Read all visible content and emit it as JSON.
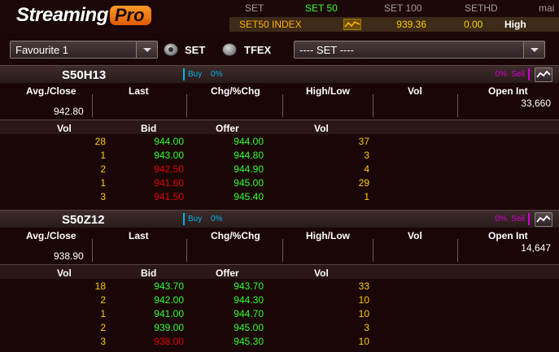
{
  "logo": {
    "part1": "Streaming",
    "part2": "Pro"
  },
  "index_tabs": [
    {
      "label": "SET",
      "active": false
    },
    {
      "label": "SET 50",
      "active": true
    },
    {
      "label": "SET 100",
      "active": false
    },
    {
      "label": "SETHD",
      "active": false
    },
    {
      "label": "mai",
      "active": false
    }
  ],
  "index_row": {
    "name": "SET50 INDEX",
    "last": "939.36",
    "change": "0.00",
    "high_low_label": "High"
  },
  "selector": {
    "favourite": "Favourite 1",
    "radio_set": "SET",
    "radio_tfex": "TFEX",
    "set_dropdown": "---- SET ----"
  },
  "columns": {
    "avg_close": "Avg./Close",
    "last": "Last",
    "chg": "Chg/%Chg",
    "high_low": "High/Low",
    "vol": "Vol",
    "open_int": "Open Int"
  },
  "book_columns": {
    "vol_bid": "Vol",
    "bid": "Bid",
    "offer": "Offer",
    "vol_offer": "Vol"
  },
  "colors": {
    "buy": "#00b4e6",
    "sell": "#d400d4",
    "up": "#33ff33",
    "down": "#e00000",
    "volume": "#ffcc00",
    "accent": "#ff8a00"
  },
  "panels": [
    {
      "symbol": "S50H13",
      "buy_label": "Buy",
      "buy_pct": "0%",
      "sell_label": "Sell",
      "sell_pct": "0%",
      "close": "942.80",
      "open_int": "33,660",
      "book": [
        {
          "bid_vol": "28",
          "bid": "944.00",
          "bid_color": "green",
          "offer": "944.00",
          "offer_vol": "37"
        },
        {
          "bid_vol": "1",
          "bid": "943.00",
          "bid_color": "green",
          "offer": "944.80",
          "offer_vol": "3"
        },
        {
          "bid_vol": "2",
          "bid": "942.50",
          "bid_color": "red",
          "offer": "944.90",
          "offer_vol": "4"
        },
        {
          "bid_vol": "1",
          "bid": "941.60",
          "bid_color": "red",
          "offer": "945.00",
          "offer_vol": "29"
        },
        {
          "bid_vol": "3",
          "bid": "941.50",
          "bid_color": "red",
          "offer": "945.40",
          "offer_vol": "1"
        }
      ]
    },
    {
      "symbol": "S50Z12",
      "buy_label": "Buy",
      "buy_pct": "0%",
      "sell_label": "Sell",
      "sell_pct": "0%",
      "close": "938.90",
      "open_int": "14,647",
      "book": [
        {
          "bid_vol": "18",
          "bid": "943.70",
          "bid_color": "green",
          "offer": "943.70",
          "offer_vol": "33"
        },
        {
          "bid_vol": "2",
          "bid": "942.00",
          "bid_color": "green",
          "offer": "944.30",
          "offer_vol": "10"
        },
        {
          "bid_vol": "1",
          "bid": "941.00",
          "bid_color": "green",
          "offer": "944.70",
          "offer_vol": "10"
        },
        {
          "bid_vol": "2",
          "bid": "939.00",
          "bid_color": "green",
          "offer": "945.00",
          "offer_vol": "3"
        },
        {
          "bid_vol": "3",
          "bid": "938.00",
          "bid_color": "red",
          "offer": "945.30",
          "offer_vol": "10"
        }
      ]
    }
  ]
}
